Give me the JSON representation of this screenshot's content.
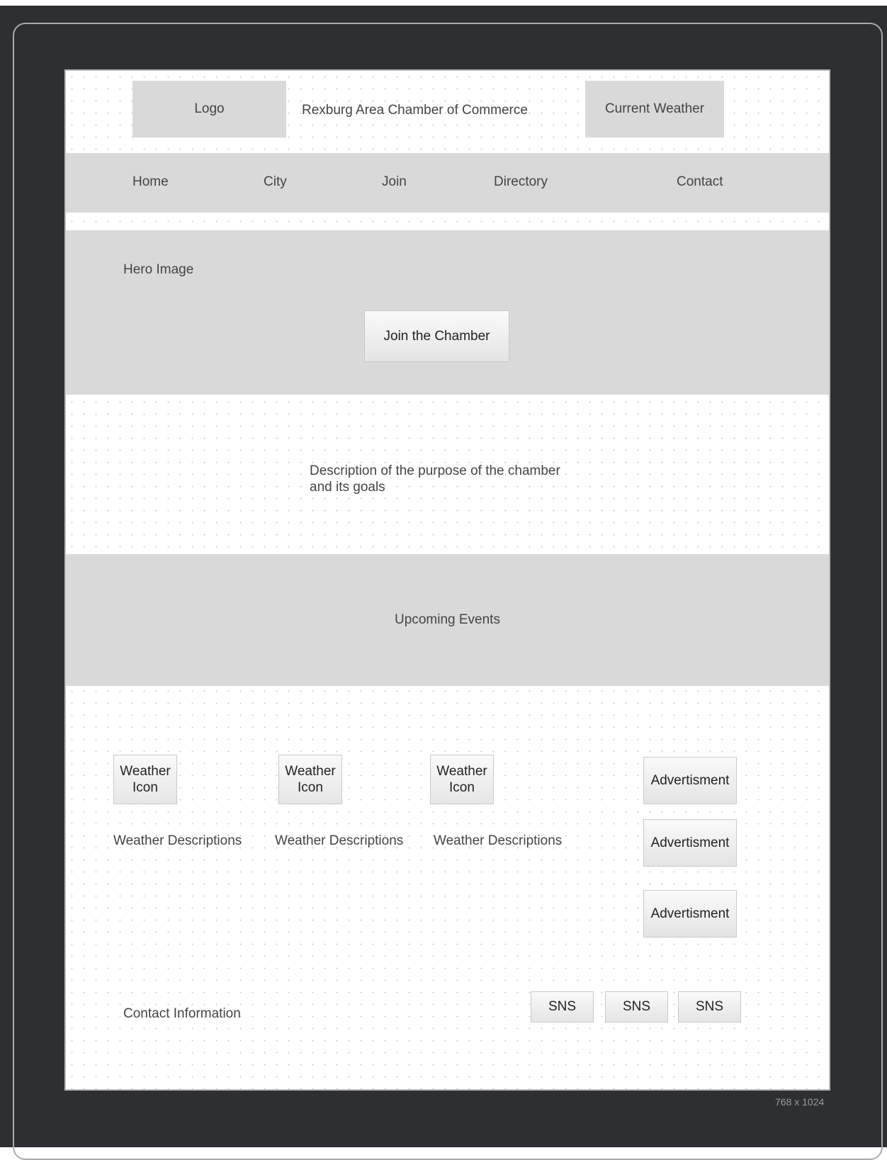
{
  "header": {
    "logo": "Logo",
    "title": "Rexburg Area Chamber of Commerce",
    "weather": "Current Weather"
  },
  "nav": {
    "items": [
      "Home",
      "City",
      "Join",
      "Directory",
      "Contact"
    ]
  },
  "hero": {
    "label": "Hero Image",
    "cta": "Join the Chamber"
  },
  "description": {
    "line1": "Description of the purpose of the chamber",
    "line2": "and its goals"
  },
  "events": {
    "label": "Upcoming Events"
  },
  "weather_cards": [
    {
      "icon_line1": "Weather",
      "icon_line2": "Icon",
      "desc": "Weather Descriptions"
    },
    {
      "icon_line1": "Weather",
      "icon_line2": "Icon",
      "desc": "Weather Descriptions"
    },
    {
      "icon_line1": "Weather",
      "icon_line2": "Icon",
      "desc": "Weather Descriptions"
    }
  ],
  "ads": [
    "Advertisment",
    "Advertisment",
    "Advertisment"
  ],
  "footer": {
    "contact": "Contact Information",
    "sns": [
      "SNS",
      "SNS",
      "SNS"
    ]
  },
  "device": {
    "size_label": "768 x 1024"
  }
}
